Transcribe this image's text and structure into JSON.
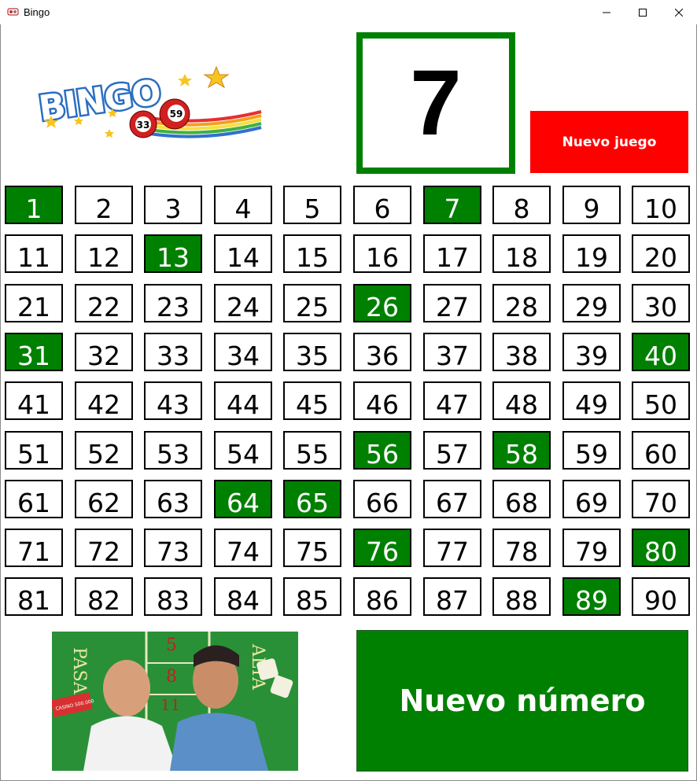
{
  "window": {
    "title": "Bingo",
    "controls": [
      "minimize",
      "maximize",
      "close"
    ]
  },
  "logo": {
    "text": "BINGO",
    "ball_numbers": [
      "33",
      "59"
    ]
  },
  "current": {
    "number": "7"
  },
  "buttons": {
    "new_game": "Nuevo juego",
    "new_number": "Nuevo número"
  },
  "board": {
    "numbers": [
      "1",
      "2",
      "3",
      "4",
      "5",
      "6",
      "7",
      "8",
      "9",
      "10",
      "11",
      "12",
      "13",
      "14",
      "15",
      "16",
      "17",
      "18",
      "19",
      "20",
      "21",
      "22",
      "23",
      "24",
      "25",
      "26",
      "27",
      "28",
      "29",
      "30",
      "31",
      "32",
      "33",
      "34",
      "35",
      "36",
      "37",
      "38",
      "39",
      "40",
      "41",
      "42",
      "43",
      "44",
      "45",
      "46",
      "47",
      "48",
      "49",
      "50",
      "51",
      "52",
      "53",
      "54",
      "55",
      "56",
      "57",
      "58",
      "59",
      "60",
      "61",
      "62",
      "63",
      "64",
      "65",
      "66",
      "67",
      "68",
      "69",
      "70",
      "71",
      "72",
      "73",
      "74",
      "75",
      "76",
      "77",
      "78",
      "79",
      "80",
      "81",
      "82",
      "83",
      "84",
      "85",
      "86",
      "87",
      "88",
      "89",
      "90"
    ],
    "drawn": [
      1,
      7,
      13,
      26,
      31,
      40,
      56,
      58,
      64,
      65,
      76,
      80,
      89
    ],
    "drawn_color": "#008000"
  },
  "photo": {
    "texts": [
      "PASA",
      "ALTA",
      "CASINO 500.000",
      "5",
      "8",
      "11"
    ]
  },
  "colors": {
    "accent_green": "#008000",
    "new_game_red": "#ff0000"
  }
}
